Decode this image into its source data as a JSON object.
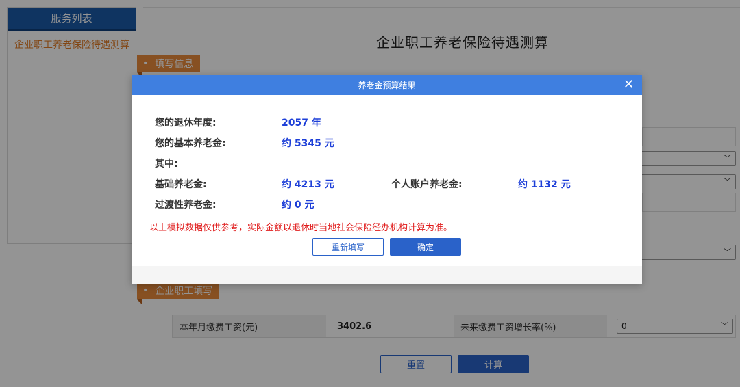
{
  "sidebar": {
    "header": "服务列表",
    "items": [
      {
        "label": "企业职工养老保险待遇测算"
      }
    ]
  },
  "page": {
    "title": "企业职工养老保险待遇测算"
  },
  "sections": {
    "fill_info": "填写信息",
    "enterprise_fill": "企业职工填写"
  },
  "form": {
    "monthly_wage_label": "本年月缴费工资(元)",
    "monthly_wage_value": "3402.6",
    "growth_rate_label": "未来缴费工资增长率(%)",
    "growth_rate_value": "0"
  },
  "bg_buttons": {
    "reset": "重置",
    "calculate": "计算"
  },
  "modal": {
    "title": "养老金预算结果",
    "close_symbol": "✕",
    "retire_year_label": "您的退休年度:",
    "retire_year_value": "2057 年",
    "basic_pension_label": "您的基本养老金:",
    "basic_pension_value": "约 5345 元",
    "of_which_label": "其中:",
    "base_pension_label": "基础养老金:",
    "base_pension_value": "约 4213 元",
    "personal_account_label": "个人账户养老金:",
    "personal_account_value": "约 1132 元",
    "transitional_label": "过渡性养老金:",
    "transitional_value": "约 0 元",
    "notice": "以上模拟数据仅供参考，实际金额以退休时当地社会保险经办机构计算为准。",
    "refill_button": "重新填写",
    "confirm_button": "确定"
  },
  "colors": {
    "primary_blue": "#2a62c9",
    "header_blue": "#3f7fe0",
    "sidebar_blue": "#1a5aa8",
    "orange_accent": "#e98a3c",
    "value_blue": "#1d3fd8",
    "notice_red": "#e01c1c"
  }
}
